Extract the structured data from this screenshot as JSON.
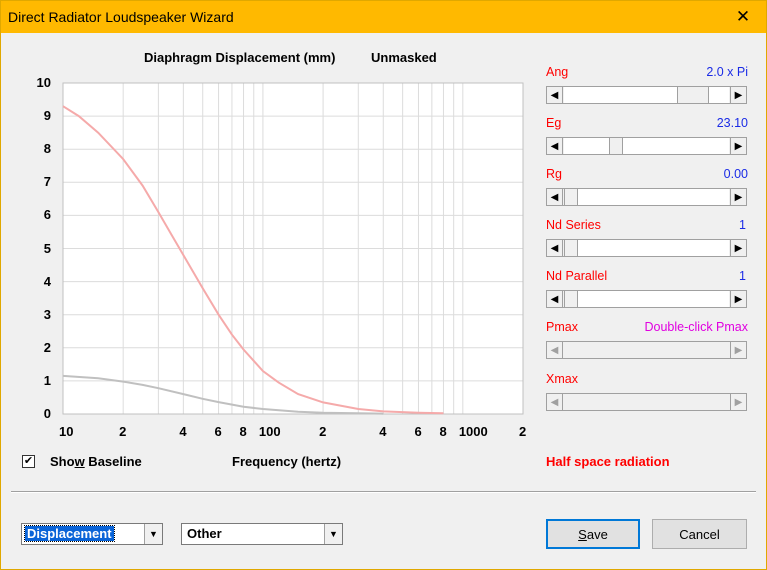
{
  "window": {
    "title": "Direct Radiator Loudspeaker Wizard"
  },
  "chart_data": {
    "type": "line",
    "title": "Diaphragm Displacement (mm)",
    "subtitle": "Unmasked",
    "xlabel": "Frequency (hertz)",
    "ylabel": "",
    "x_scale": "log",
    "xlim": [
      10,
      2000
    ],
    "ylim": [
      0,
      10
    ],
    "y_ticks": [
      "0",
      "1",
      "2",
      "3",
      "4",
      "5",
      "6",
      "7",
      "8",
      "9",
      "10"
    ],
    "x_ticks": [
      {
        "value": 10,
        "label": "10"
      },
      {
        "value": 20,
        "label": "2"
      },
      {
        "value": 40,
        "label": "4"
      },
      {
        "value": 60,
        "label": "6"
      },
      {
        "value": 80,
        "label": "8"
      },
      {
        "value": 100,
        "label": "100"
      },
      {
        "value": 200,
        "label": "2"
      },
      {
        "value": 400,
        "label": "4"
      },
      {
        "value": 600,
        "label": "6"
      },
      {
        "value": 800,
        "label": "8"
      },
      {
        "value": 1000,
        "label": "1000"
      },
      {
        "value": 2000,
        "label": "2"
      }
    ],
    "grid": true,
    "series": [
      {
        "color": "#f5aaaa",
        "x": [
          10,
          12,
          15,
          20,
          25,
          30,
          35,
          40,
          50,
          60,
          70,
          80,
          100,
          120,
          150,
          200,
          300,
          400,
          600,
          800
        ],
        "y": [
          9.3,
          9.0,
          8.5,
          7.7,
          6.9,
          6.1,
          5.4,
          4.8,
          3.8,
          3.0,
          2.4,
          1.95,
          1.3,
          0.95,
          0.6,
          0.35,
          0.15,
          0.08,
          0.04,
          0.02
        ]
      },
      {
        "color": "#c0c0c0",
        "x": [
          10,
          15,
          20,
          25,
          30,
          40,
          50,
          60,
          80,
          100,
          150,
          200,
          300,
          400
        ],
        "y": [
          1.15,
          1.08,
          0.98,
          0.88,
          0.78,
          0.6,
          0.46,
          0.36,
          0.22,
          0.15,
          0.07,
          0.04,
          0.02,
          0.01
        ]
      }
    ]
  },
  "controls": {
    "ang": {
      "label": "Ang",
      "value": "2.0 x Pi",
      "position": 0.85
    },
    "eg": {
      "label": "Eg",
      "value": "23.10",
      "position": 0.3
    },
    "rg": {
      "label": "Rg",
      "value": "0.00",
      "position": 0.0
    },
    "nd_series": {
      "label": "Nd  Series",
      "value": "1",
      "position": 0.0
    },
    "nd_parallel": {
      "label": "Nd  Parallel",
      "value": "1",
      "position": 0.0
    },
    "pmax": {
      "label": "Pmax",
      "value": "Double-click Pmax"
    },
    "xmax": {
      "label": "Xmax",
      "value": ""
    }
  },
  "show_baseline": {
    "label_pre": "Sho",
    "label_ul": "w",
    "label_post": " Baseline",
    "checked": "✔"
  },
  "status_text": "Half space radiation",
  "combo_type": {
    "value": "Displacement"
  },
  "combo_other": {
    "value": "Other"
  },
  "buttons": {
    "save_pre": "",
    "save_ul": "S",
    "save_post": "ave",
    "cancel": "Cancel"
  },
  "icons": {
    "close": "close-icon",
    "arrow_left": "scroll-left-icon",
    "arrow_right": "scroll-right-icon",
    "dropdown": "chevron-down-icon",
    "check": "check-icon"
  }
}
